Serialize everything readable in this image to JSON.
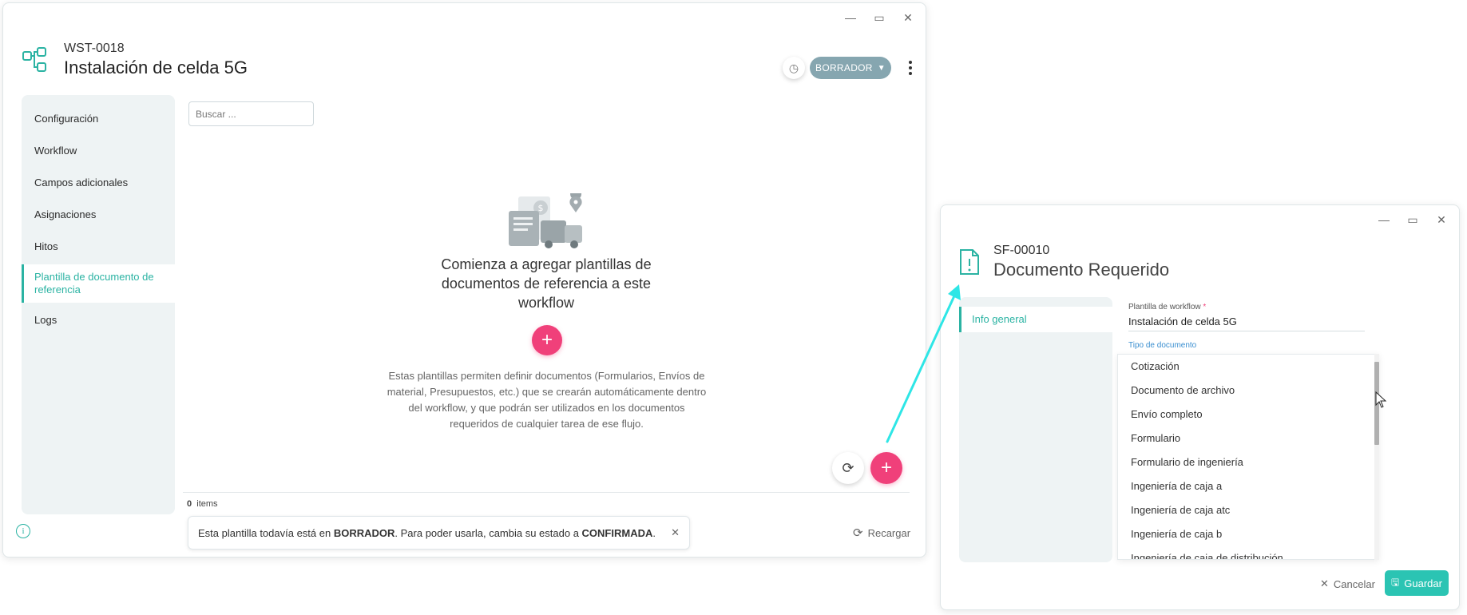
{
  "window1": {
    "code": "WST-0018",
    "title": "Instalación de celda 5G",
    "status": "BORRADOR",
    "sidebar": [
      {
        "label": "Configuración"
      },
      {
        "label": "Workflow"
      },
      {
        "label": "Campos adicionales"
      },
      {
        "label": "Asignaciones"
      },
      {
        "label": "Hitos"
      },
      {
        "label": "Plantilla de documento de referencia"
      },
      {
        "label": "Logs"
      }
    ],
    "search_placeholder": "Buscar ...",
    "empty_title": "Comienza a agregar plantillas de documentos de referencia a este workflow",
    "empty_desc": "Estas plantillas permiten definir documentos (Formularios, Envíos de material, Presupuestos, etc.) que se crearán automáticamente dentro del workflow, y que podrán ser utilizados en los documentos requeridos de cualquier tarea de ese flujo.",
    "items_count": "0",
    "items_label": "items",
    "toast": {
      "part1": "Esta plantilla todavía está en ",
      "bold1": "BORRADOR",
      "part2": ". Para poder usarla, cambia su estado a ",
      "bold2": "CONFIRMADA",
      "part3": "."
    },
    "reload_label": "Recargar"
  },
  "window2": {
    "code": "SF-00010",
    "title": "Documento Requerido",
    "sidebar": [
      {
        "label": "Info general"
      }
    ],
    "field1_label": "Plantilla de workflow",
    "field1_required": "*",
    "field1_value": "Instalación de celda 5G",
    "field2_label": "Tipo de documento",
    "options": [
      "Cotización",
      "Documento de archivo",
      "Envío completo",
      "Formulario",
      "Formulario de ingeniería",
      "Ingeniería de caja a",
      "Ingeniería de caja atc",
      "Ingeniería de caja b",
      "Ingeniería de caja de distribución"
    ],
    "cancel_label": "Cancelar",
    "save_label": "Guardar"
  },
  "colors": {
    "accent": "#2bb3a3",
    "pink": "#f0407a",
    "status": "#86a6b0",
    "arrow": "#2ee6e6"
  }
}
